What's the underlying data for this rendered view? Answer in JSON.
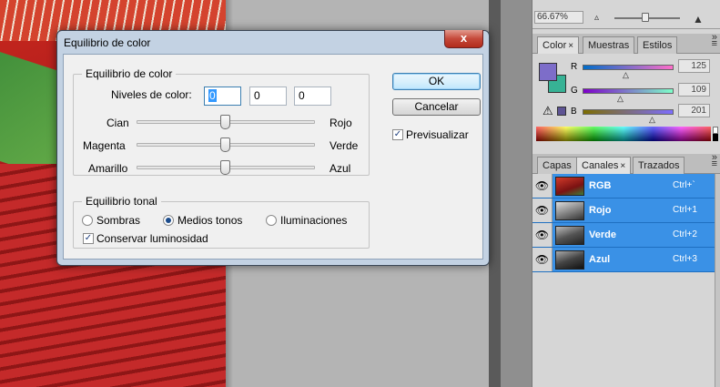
{
  "dialog": {
    "title": "Equilibrio de color",
    "close_label": "x",
    "color_balance_legend": "Equilibrio de color",
    "levels_label": "Niveles de color:",
    "levels": [
      "0",
      "0",
      "0"
    ],
    "sliders": [
      {
        "left": "Cian",
        "right": "Rojo",
        "value": 0
      },
      {
        "left": "Magenta",
        "right": "Verde",
        "value": 0
      },
      {
        "left": "Amarillo",
        "right": "Azul",
        "value": 0
      }
    ],
    "tonal_legend": "Equilibrio tonal",
    "tones": [
      "Sombras",
      "Medios tonos",
      "Iluminaciones"
    ],
    "tone_selected": "Medios tonos",
    "preserve_label": "Conservar luminosidad",
    "preserve_checked": true,
    "ok_label": "OK",
    "cancel_label": "Cancelar",
    "preview_label": "Previsualizar",
    "preview_checked": true
  },
  "navigator": {
    "zoom": "66.67%"
  },
  "color_panel": {
    "tabs": [
      "Color",
      "Muestras",
      "Estilos"
    ],
    "active_tab": "Color",
    "close_mark": "×",
    "channels": [
      {
        "label": "R",
        "value": "125"
      },
      {
        "label": "G",
        "value": "109"
      },
      {
        "label": "B",
        "value": "201"
      }
    ],
    "foreground": "#7d6dc9",
    "background": "#37b295"
  },
  "channels_panel": {
    "tabs": [
      "Capas",
      "Canales",
      "Trazados"
    ],
    "active_tab": "Canales",
    "close_mark": "×",
    "rows": [
      {
        "name": "RGB",
        "shortcut": "Ctrl+`"
      },
      {
        "name": "Rojo",
        "shortcut": "Ctrl+1"
      },
      {
        "name": "Verde",
        "shortcut": "Ctrl+2"
      },
      {
        "name": "Azul",
        "shortcut": "Ctrl+3"
      }
    ]
  }
}
